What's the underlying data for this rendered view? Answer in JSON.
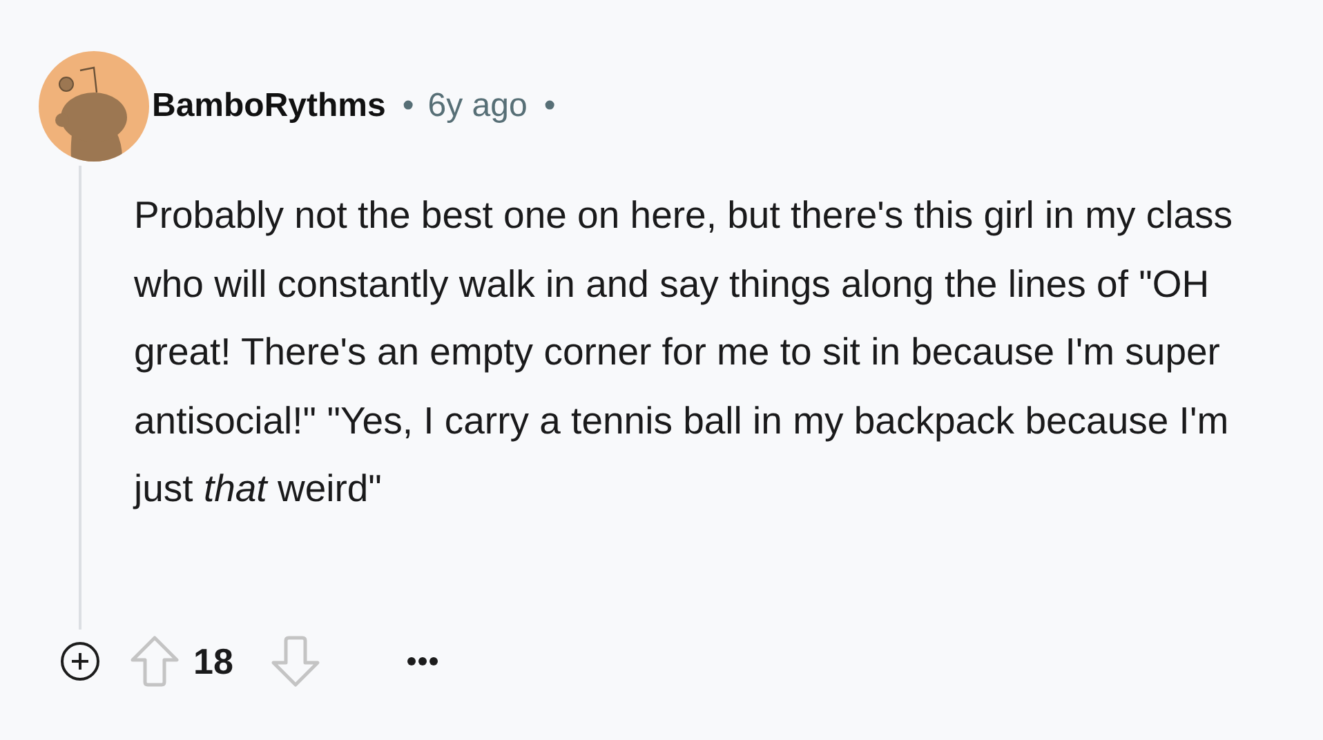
{
  "comment": {
    "author": "BamboRythms",
    "separator": "•",
    "time": "6y ago",
    "trailing_separator": "•",
    "body": "Probably not the best one on here, but there's this girl in my class who will constantly walk in and say things along the lines of \"OH great! There's an empty corner for me to sit in because I'm super antisocial!\" \"Yes, I carry a tennis ball in my backpack because I'm just *that* weird\"",
    "score": "18"
  }
}
